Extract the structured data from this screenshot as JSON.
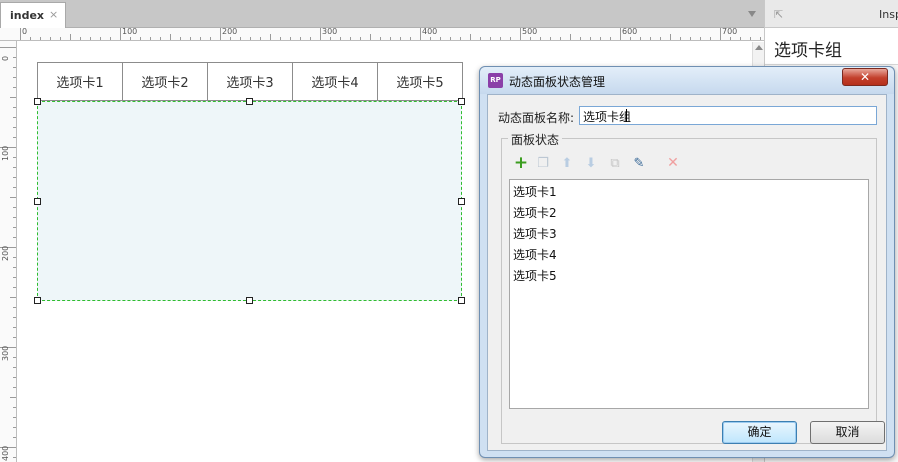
{
  "document_tab": {
    "label": "index",
    "close_glyph": "×"
  },
  "ruler": {
    "h_labels": [
      "0",
      "100",
      "200",
      "300",
      "400",
      "500",
      "600",
      "700"
    ],
    "v_labels": [
      "0",
      "100",
      "200",
      "300",
      "400"
    ]
  },
  "canvas": {
    "tabs": [
      "选项卡1",
      "选项卡2",
      "选项卡3",
      "选项卡4",
      "选项卡5"
    ],
    "panel_fill": "#eef6f9",
    "panel_border": "#2fbd2f"
  },
  "inspector": {
    "pin_glyph": "⇱",
    "title": "Inspector",
    "widget_name": "选项卡组"
  },
  "dialog": {
    "icon_text": "RP",
    "title": "动态面板状态管理",
    "close_glyph": "✕",
    "name_label": "动态面板名称:",
    "name_value": "选项卡组",
    "group_label": "面板状态",
    "toolbar_icons": [
      "add-icon",
      "duplicate-icon",
      "move-up-icon",
      "move-down-icon",
      "copy-icon",
      "edit-icon",
      "delete-icon"
    ],
    "states": [
      "选项卡1",
      "选项卡2",
      "选项卡3",
      "选项卡4",
      "选项卡5"
    ],
    "ok_label": "确定",
    "cancel_label": "取消"
  }
}
